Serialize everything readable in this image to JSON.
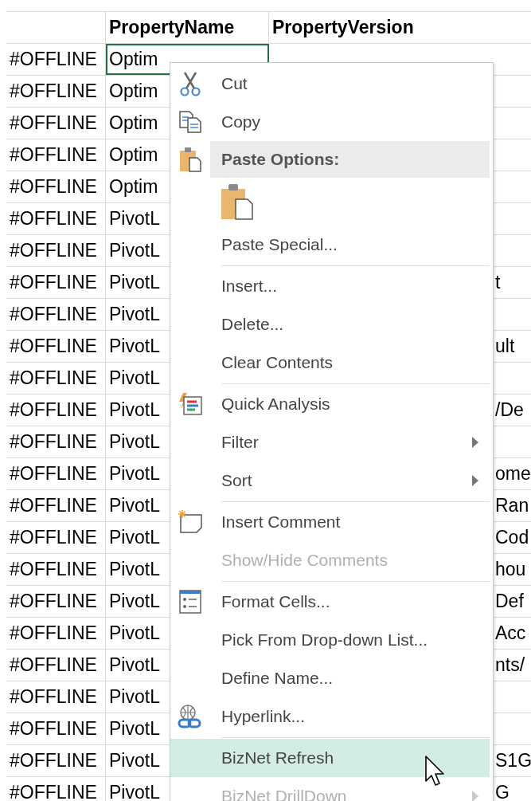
{
  "columns": [
    {
      "label": "PropertyName"
    },
    {
      "label": "PropertyVersion"
    }
  ],
  "rows": [
    {
      "column_1": "#OFFLINE",
      "PropertyName": "Optim",
      "selected": true
    },
    {
      "column_1": "#OFFLINE",
      "PropertyName": "Optim",
      "selected": false
    },
    {
      "column_1": "#OFFLINE",
      "PropertyName": "Optim",
      "selected": false
    },
    {
      "column_1": "#OFFLINE",
      "PropertyName": "Optim",
      "selected": false
    },
    {
      "column_1": "#OFFLINE",
      "PropertyName": "Optim",
      "selected": false
    },
    {
      "column_1": "#OFFLINE",
      "PropertyName": "PivotL",
      "selected": false
    },
    {
      "column_1": "#OFFLINE",
      "PropertyName": "PivotL",
      "selected": false
    },
    {
      "column_1": "#OFFLINE",
      "PropertyName": "PivotL",
      "selected": false,
      "PropertyVersion": "t",
      "kind": "tail"
    },
    {
      "column_1": "#OFFLINE",
      "PropertyName": "PivotL",
      "selected": false
    },
    {
      "column_1": "#OFFLINE",
      "PropertyName": "PivotL",
      "selected": false,
      "PropertyVersion": "ult",
      "kind": "tail"
    },
    {
      "column_1": "#OFFLINE",
      "PropertyName": "PivotL",
      "selected": false
    },
    {
      "column_1": "#OFFLINE",
      "PropertyName": "PivotL",
      "selected": false,
      "PropertyVersion": "/De",
      "kind": "tail"
    },
    {
      "column_1": "#OFFLINE",
      "PropertyName": "PivotL",
      "selected": false
    },
    {
      "column_1": "#OFFLINE",
      "PropertyName": "PivotL",
      "selected": false,
      "PropertyVersion": "ome",
      "kind": "tail"
    },
    {
      "column_1": "#OFFLINE",
      "PropertyName": "PivotL",
      "selected": false,
      "PropertyVersion": "Ran",
      "kind": "tail"
    },
    {
      "column_1": "#OFFLINE",
      "PropertyName": "PivotL",
      "selected": false,
      "PropertyVersion": "Cod",
      "kind": "tail"
    },
    {
      "column_1": "#OFFLINE",
      "PropertyName": "PivotL",
      "selected": false,
      "PropertyVersion": "hou",
      "kind": "tail"
    },
    {
      "column_1": "#OFFLINE",
      "PropertyName": "PivotL",
      "selected": false,
      "PropertyVersion": "Def",
      "kind": "tail"
    },
    {
      "column_1": "#OFFLINE",
      "PropertyName": "PivotL",
      "selected": false,
      "PropertyVersion": "Acc",
      "kind": "tail"
    },
    {
      "column_1": "#OFFLINE",
      "PropertyName": "PivotL",
      "selected": false,
      "PropertyVersion": "nts/",
      "kind": "tail"
    },
    {
      "column_1": "#OFFLINE",
      "PropertyName": "PivotL",
      "selected": false
    },
    {
      "column_1": "#OFFLINE",
      "PropertyName": "PivotL",
      "selected": false
    },
    {
      "column_1": "#OFFLINE",
      "PropertyName": "PivotL",
      "selected": false,
      "PropertyVersion": "S1G",
      "kind": "tail"
    },
    {
      "column_1": "#OFFLINE",
      "PropertyName": "PivotL",
      "selected": false,
      "PropertyVersion": "G",
      "kind": "tail"
    }
  ],
  "context_menu": [
    {
      "kind": "item",
      "label": "Cut",
      "disabled": false,
      "selected": false
    },
    {
      "kind": "item",
      "label": "Copy",
      "disabled": false,
      "selected": false
    },
    {
      "kind": "header",
      "label": "Paste Options:"
    },
    {
      "kind": "paste-button"
    },
    {
      "kind": "item",
      "label": "Paste Special...",
      "disabled": false,
      "selected": false
    },
    {
      "kind": "separator"
    },
    {
      "kind": "item",
      "label": "Insert...",
      "disabled": false,
      "selected": false
    },
    {
      "kind": "item",
      "label": "Delete...",
      "disabled": false,
      "selected": false
    },
    {
      "kind": "item",
      "label": "Clear Contents",
      "disabled": false,
      "selected": false
    },
    {
      "kind": "separator"
    },
    {
      "kind": "item",
      "label": "Quick Analysis",
      "disabled": false,
      "selected": false
    },
    {
      "kind": "item",
      "label": "Filter",
      "submenu": true,
      "disabled": false,
      "selected": false
    },
    {
      "kind": "item",
      "label": "Sort",
      "submenu": true,
      "disabled": false,
      "selected": false
    },
    {
      "kind": "separator"
    },
    {
      "kind": "item",
      "label": "Insert Comment",
      "disabled": false,
      "selected": false
    },
    {
      "kind": "item",
      "label": "Show/Hide Comments",
      "disabled": true,
      "selected": false
    },
    {
      "kind": "separator"
    },
    {
      "kind": "item",
      "label": "Format Cells...",
      "disabled": false,
      "selected": false
    },
    {
      "kind": "item",
      "label": "Pick From Drop-down List...",
      "disabled": false,
      "selected": false
    },
    {
      "kind": "item",
      "label": "Define Name...",
      "disabled": false,
      "selected": false
    },
    {
      "kind": "item",
      "label": "Hyperlink...",
      "disabled": false,
      "selected": false
    },
    {
      "kind": "separator"
    },
    {
      "kind": "item",
      "label": "BizNet Refresh",
      "disabled": false,
      "selected": true
    },
    {
      "kind": "item",
      "label": "BizNet DrillDown",
      "submenu": true,
      "disabled": true,
      "selected": false
    }
  ]
}
